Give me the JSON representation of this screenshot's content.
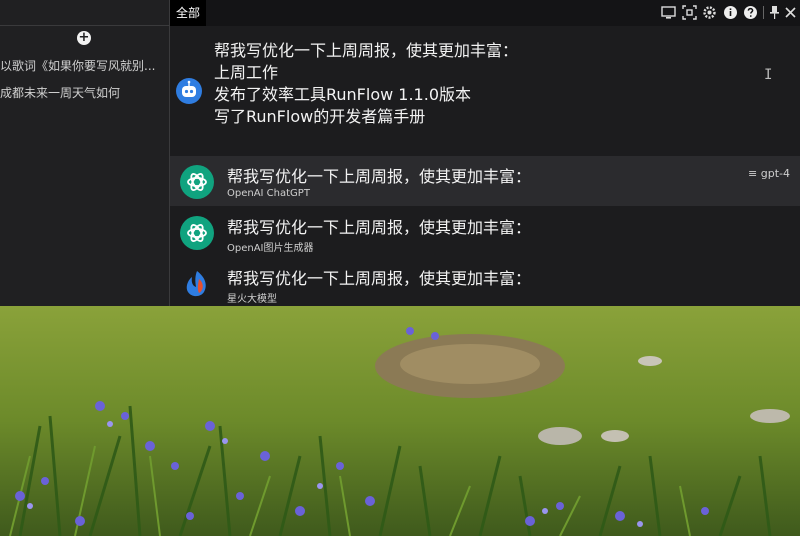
{
  "sidebar": {
    "new_chat_icon": "plus-circle-icon",
    "history": [
      "以歌词《如果你要写风就别...",
      "成都未来一周天气如何"
    ]
  },
  "topbar": {
    "tab_label": "全部",
    "icons": [
      "monitor-icon",
      "scan-icon",
      "gear-icon",
      "info-icon",
      "help-icon",
      "pin-icon",
      "close-icon"
    ]
  },
  "prompt": {
    "text": "帮我写优化一下上周周报，使其更加丰富：\n上周工作\n发布了效率工具RunFlow 1.1.0版本\n写了RunFlow的开发者篇手册",
    "avatar_icon": "robot-icon"
  },
  "suggestions": [
    {
      "title": "帮我写优化一下上周周报，使其更加丰富：",
      "subtitle": "OpenAI ChatGPT",
      "badge": "≡ gpt-4",
      "icon": "openai-icon",
      "selected": true
    },
    {
      "title": "帮我写优化一下上周周报，使其更加丰富：",
      "subtitle": "OpenAI图片生成器",
      "badge": "",
      "icon": "openai-icon",
      "selected": false
    },
    {
      "title": "帮我写优化一下上周周报，使其更加丰富：",
      "subtitle": "星火大模型",
      "badge": "",
      "icon": "spark-icon",
      "selected": false
    }
  ],
  "colors": {
    "app_background": "#1c1c1e",
    "sidebar_background": "#202022",
    "selected_row": "#2b2b2e",
    "openai_green": "#10a37f",
    "robot_blue": "#2f7de1"
  }
}
